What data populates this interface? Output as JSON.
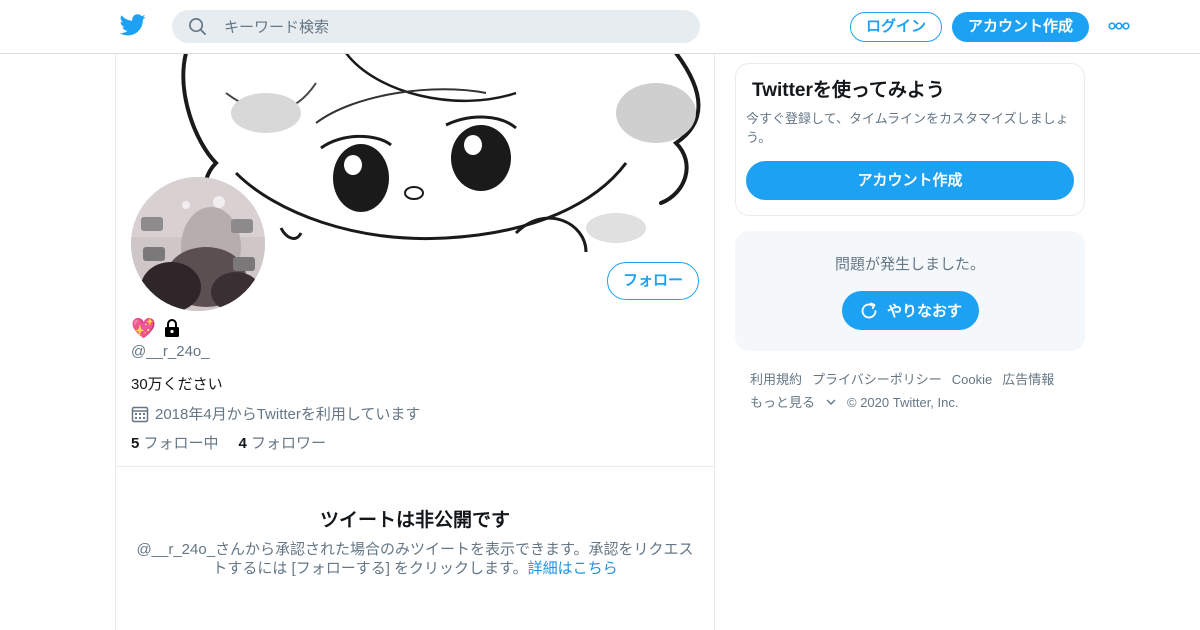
{
  "header": {
    "logo_icon": "twitter-bird-icon",
    "search_placeholder": "キーワード検索",
    "login_label": "ログイン",
    "signup_label": "アカウント作成",
    "more_icon": "more-dots-icon"
  },
  "profile": {
    "name_emoji_1": "💖",
    "name_emoji_2": "🔒",
    "handle": "@__r_24o_",
    "bio": "30万ください",
    "joined": "2018年4月からTwitterを利用しています",
    "following_count": "5",
    "following_label": "フォロー中",
    "followers_count": "4",
    "followers_label": "フォロワー",
    "follow_label": "フォロー"
  },
  "private_notice": {
    "title": "ツイートは非公開です",
    "body": "@__r_24o_さんから承認された場合のみツイートを表示できます。承認をリクエストするには [フォローする] をクリックします。",
    "link": "詳細はこちら"
  },
  "sidebar": {
    "signup_card": {
      "title": "Twitterを使ってみよう",
      "subtitle": "今すぐ登録して、タイムラインをカスタマイズしましょう。",
      "button": "アカウント作成"
    },
    "error_card": {
      "message": "問題が発生しました。",
      "retry": "やりなおす"
    },
    "footer": {
      "terms": "利用規約",
      "privacy": "プライバシーポリシー",
      "cookie": "Cookie",
      "ads": "広告情報",
      "more": "もっと見る",
      "copyright": "© 2020 Twitter, Inc."
    }
  },
  "colors": {
    "accent": "#1da1f2",
    "muted_text": "#657786",
    "border": "#e6ecf0",
    "panel_bg": "#f5f8fa"
  }
}
